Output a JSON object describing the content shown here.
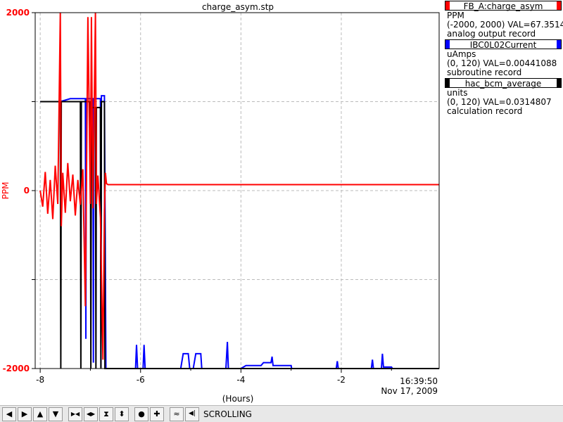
{
  "chart_data": {
    "type": "line",
    "title": "charge_asym.stp",
    "xlabel": "(Hours)",
    "x_ticks": [
      "-8",
      "-6",
      "-4",
      "-2"
    ],
    "time_label": "16:39:50",
    "date_label": "Nov 17, 2009",
    "xlim": [
      -8.1,
      -0.05
    ],
    "left_axis": {
      "label": "PPM",
      "color": "#ff0000",
      "ylim": [
        -2000,
        2000
      ],
      "ticks": [
        "2000",
        "0",
        "-2000"
      ]
    },
    "grid": true,
    "legend_placement": "right",
    "series": [
      {
        "name": "FB_A:charge_asym",
        "units": "PPM",
        "range": "(-2000, 2000)",
        "val": "VAL=67.3514",
        "record": "analog output record",
        "color": "#ff0000",
        "ylim": [
          -2000,
          2000
        ],
        "points": [
          [
            -8.0,
            0
          ],
          [
            -7.95,
            -180
          ],
          [
            -7.9,
            210
          ],
          [
            -7.85,
            -260
          ],
          [
            -7.8,
            120
          ],
          [
            -7.75,
            -320
          ],
          [
            -7.7,
            280
          ],
          [
            -7.65,
            -150
          ],
          [
            -7.6,
            2000
          ],
          [
            -7.58,
            -400
          ],
          [
            -7.55,
            200
          ],
          [
            -7.5,
            -250
          ],
          [
            -7.45,
            310
          ],
          [
            -7.4,
            -120
          ],
          [
            -7.35,
            180
          ],
          [
            -7.3,
            -280
          ],
          [
            -7.25,
            120
          ],
          [
            -7.2,
            -160
          ],
          [
            -7.15,
            240
          ],
          [
            -7.1,
            -1300
          ],
          [
            -7.05,
            1950
          ],
          [
            -7.0,
            -150
          ],
          [
            -6.98,
            1950
          ],
          [
            -6.95,
            -200
          ],
          [
            -6.9,
            2000
          ],
          [
            -6.88,
            -150
          ],
          [
            -6.85,
            170
          ],
          [
            -6.8,
            -300
          ],
          [
            -6.75,
            -1900
          ],
          [
            -6.72,
            -220
          ],
          [
            -6.7,
            200
          ],
          [
            -6.68,
            80
          ],
          [
            -6.65,
            67
          ],
          [
            -0.05,
            67
          ]
        ]
      },
      {
        "name": "IBC0L02Current",
        "units": "uAmps",
        "range": "(0, 120)",
        "val": "VAL=0.00441088",
        "record": "subroutine record",
        "color": "#0000ff",
        "ylim": [
          0,
          120
        ],
        "points": [
          [
            -8.0,
            90
          ],
          [
            -7.8,
            90
          ],
          [
            -7.6,
            90
          ],
          [
            -7.4,
            91
          ],
          [
            -7.2,
            91
          ],
          [
            -7.1,
            91
          ],
          [
            -7.09,
            10
          ],
          [
            -7.08,
            91
          ],
          [
            -6.95,
            91
          ],
          [
            -6.94,
            2
          ],
          [
            -6.93,
            91
          ],
          [
            -6.8,
            91
          ],
          [
            -6.79,
            0.5
          ],
          [
            -6.78,
            92
          ],
          [
            -6.72,
            92
          ],
          [
            -6.7,
            30
          ],
          [
            -6.69,
            0
          ],
          [
            -6.1,
            0
          ],
          [
            -6.08,
            8
          ],
          [
            -6.06,
            0
          ],
          [
            -5.95,
            0
          ],
          [
            -5.93,
            8
          ],
          [
            -5.91,
            0
          ],
          [
            -5.2,
            0
          ],
          [
            -5.15,
            5
          ],
          [
            -5.05,
            5
          ],
          [
            -5.02,
            0
          ],
          [
            -4.95,
            0
          ],
          [
            -4.9,
            5
          ],
          [
            -4.8,
            5
          ],
          [
            -4.78,
            0
          ],
          [
            -4.3,
            0
          ],
          [
            -4.27,
            9
          ],
          [
            -4.25,
            0
          ],
          [
            -4.0,
            0
          ],
          [
            -3.9,
            1
          ],
          [
            -3.6,
            1
          ],
          [
            -3.55,
            2
          ],
          [
            -3.4,
            2
          ],
          [
            -3.38,
            4
          ],
          [
            -3.36,
            1
          ],
          [
            -3.1,
            1
          ],
          [
            -3.0,
            1
          ],
          [
            -2.99,
            0
          ],
          [
            -2.1,
            0
          ],
          [
            -2.08,
            2.5
          ],
          [
            -2.06,
            0
          ],
          [
            -1.4,
            0
          ],
          [
            -1.38,
            3
          ],
          [
            -1.36,
            0
          ],
          [
            -1.2,
            0
          ],
          [
            -1.18,
            5
          ],
          [
            -1.16,
            0.5
          ],
          [
            -1.0,
            0.5
          ],
          [
            -0.98,
            0
          ],
          [
            -0.05,
            0
          ]
        ]
      },
      {
        "name": "hac_bcm_average",
        "units": "units",
        "range": "(0, 120)",
        "val": "VAL=0.0314807",
        "record": "calculation record",
        "color": "#000000",
        "ylim": [
          0,
          120
        ],
        "points": [
          [
            -8.0,
            90
          ],
          [
            -7.6,
            90
          ],
          [
            -7.59,
            0
          ],
          [
            -7.58,
            90
          ],
          [
            -7.2,
            90
          ],
          [
            -7.19,
            0
          ],
          [
            -7.18,
            90
          ],
          [
            -7.0,
            90
          ],
          [
            -6.99,
            0
          ],
          [
            -6.98,
            88
          ],
          [
            -6.9,
            88
          ],
          [
            -6.89,
            0
          ],
          [
            -6.88,
            88
          ],
          [
            -6.85,
            88
          ],
          [
            -6.8,
            88
          ],
          [
            -6.79,
            0
          ],
          [
            -6.78,
            90
          ],
          [
            -6.72,
            90
          ],
          [
            -6.71,
            0
          ],
          [
            -0.05,
            0
          ]
        ]
      }
    ]
  },
  "legend": [
    {
      "name": "FB_A:charge_asym",
      "units": "PPM",
      "range_val": "(-2000, 2000) VAL=67.3514",
      "record": "analog output record",
      "color": "#ff0000"
    },
    {
      "name": "IBC0L02Current",
      "units": "uAmps",
      "range_val": "(0, 120) VAL=0.00441088",
      "record": "subroutine record",
      "color": "#0000ff"
    },
    {
      "name": "hac_bcm_average",
      "units": "units",
      "range_val": "(0, 120) VAL=0.0314807",
      "record": "calculation record",
      "color": "#000000"
    }
  ],
  "toolbar": {
    "status": "SCROLLING",
    "buttons": [
      {
        "icon": "pan-left-icon",
        "glyph": "◀"
      },
      {
        "icon": "pan-right-icon",
        "glyph": "▶"
      },
      {
        "icon": "pan-up-icon",
        "glyph": "▲"
      },
      {
        "icon": "pan-down-icon",
        "glyph": "▼"
      },
      {
        "icon": "zoom-in-x-icon",
        "glyph": "▶◀"
      },
      {
        "icon": "zoom-out-x-icon",
        "glyph": "◀▶"
      },
      {
        "icon": "zoom-in-y-icon",
        "glyph": "⧗"
      },
      {
        "icon": "zoom-out-y-icon",
        "glyph": "⬍"
      },
      {
        "icon": "auto-scale-icon",
        "glyph": "●"
      },
      {
        "icon": "add-icon",
        "glyph": "✚"
      },
      {
        "icon": "config-icon",
        "glyph": "≈"
      },
      {
        "icon": "back-icon",
        "glyph": "◀|"
      }
    ]
  }
}
